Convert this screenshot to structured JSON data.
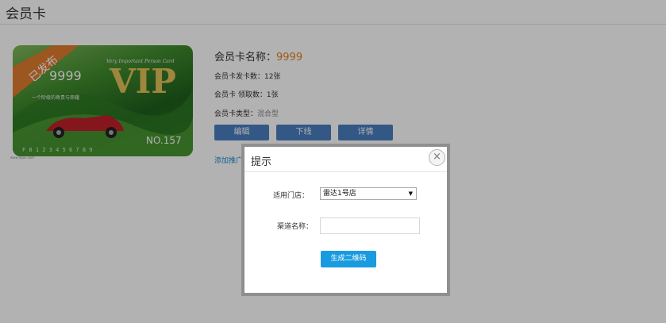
{
  "page": {
    "title": "会员卡"
  },
  "card": {
    "status_ribbon": "已发布",
    "number_badge": "9999",
    "tagline": "Very Important Person Card",
    "vip": "VIP",
    "slogan": "一个阶级的尊贵与荣耀",
    "card_no": "NO.157",
    "serial": "F 8 1 2 3 4 5 6 7 8 9",
    "caption": "www.nipic.com"
  },
  "info": {
    "name_label": "会员卡名称：",
    "name_value": "9999",
    "issued_label": "会员卡发卡数：12张",
    "claimed_label": "会员卡 领取数：1张",
    "type_label": "会员卡类型：",
    "type_value": "混合型"
  },
  "actions": {
    "edit": "编辑",
    "offline": "下线",
    "details": "详情"
  },
  "link_add": "添加推广",
  "modal": {
    "title": "提示",
    "close": "×",
    "store_label": "适用门店：",
    "store_value": "雷达1号店",
    "channel_label": "渠道名称：",
    "channel_value": "",
    "generate_btn": "生成二维码"
  },
  "colors": {
    "accent": "#1a9be0",
    "price": "#e67e22",
    "button": "#4a7fc1",
    "ribbon": "#e07b2e"
  }
}
